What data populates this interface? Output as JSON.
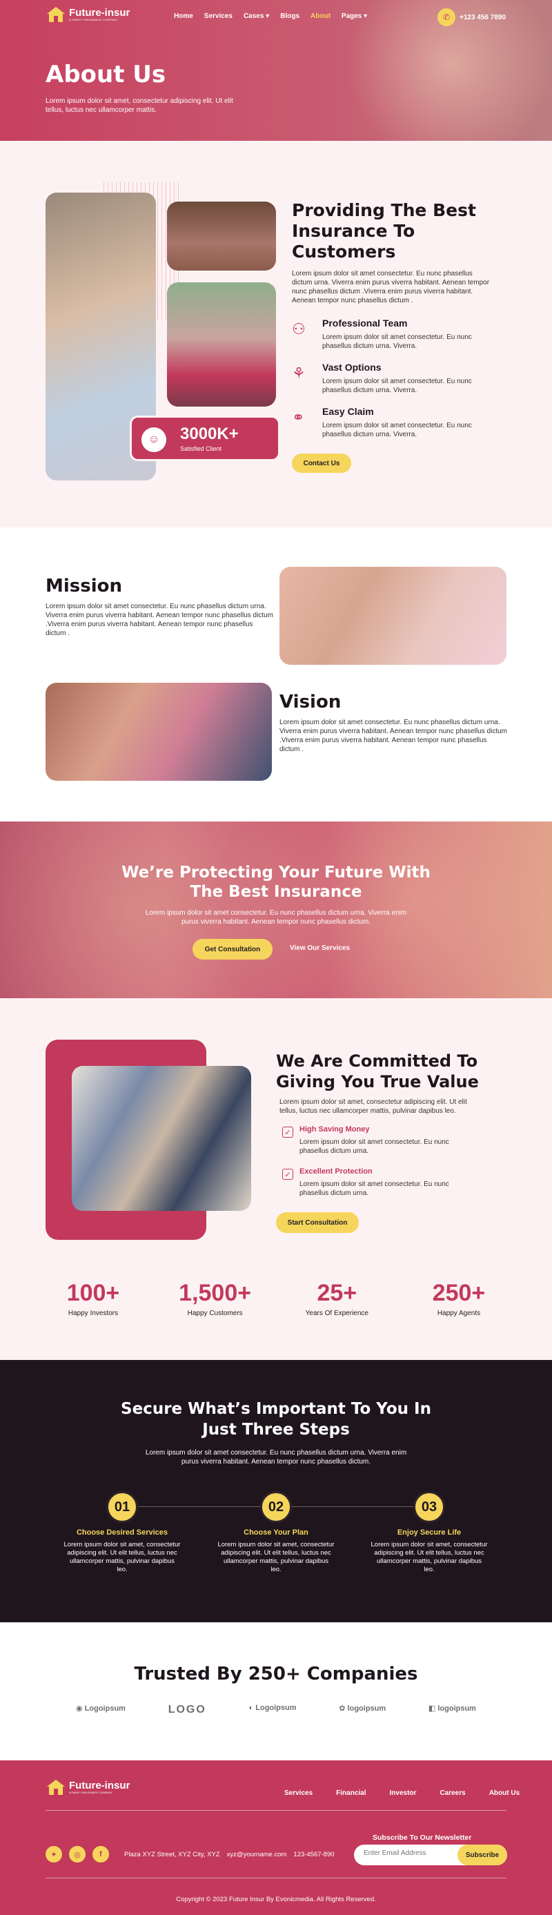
{
  "brand": {
    "name": "Future-insur",
    "tagline": "A FAMILY INSURANCE COMPANY"
  },
  "nav": {
    "items": [
      "Home",
      "Services",
      "Cases",
      "Blogs",
      "About",
      "Pages"
    ],
    "active": "About",
    "phone": "+123 456 7890"
  },
  "hero": {
    "title": "About Us",
    "text": "Lorem ipsum dolor sit amet, consectetur adipiscing elit. Ut elit tellus, luctus nec ullamcorper mattis."
  },
  "about": {
    "title": "Providing The Best Insurance To Customers",
    "text": "Lorem ipsum dolor sit amet consectetur. Eu nunc phasellus dictum urna. Viverra enim purus viverra habitant. Aenean tempor nunc phasellus dictum .Viverra enim purus viverra habitant. Aenean tempor nunc phasellus dictum .",
    "features": [
      {
        "title": "Professional Team",
        "text": "Lorem ipsum dolor sit amet consectetur. Eu nunc phasellus dictum urna. Viverra."
      },
      {
        "title": "Vast Options",
        "text": "Lorem ipsum dolor sit amet consectetur. Eu nunc phasellus dictum urna. Viverra."
      },
      {
        "title": "Easy Claim",
        "text": "Lorem ipsum dolor sit amet consectetur. Eu nunc phasellus dictum urna. Viverra."
      }
    ],
    "stat_value": "3000K+",
    "stat_label": "Satisfied Client",
    "cta": "Contact Us"
  },
  "mission": {
    "title": "Mission",
    "text": "Lorem ipsum dolor sit amet consectetur. Eu nunc phasellus dictum urna. Viverra enim purus viverra habitant. Aenean tempor nunc phasellus dictum .Viverra enim purus viverra habitant. Aenean tempor nunc phasellus dictum ."
  },
  "vision": {
    "title": "Vision",
    "text": "Lorem ipsum dolor sit amet consectetur. Eu nunc phasellus dictum urna. Viverra enim purus viverra habitant. Aenean tempor nunc phasellus dictum .Viverra enim purus viverra habitant. Aenean tempor nunc phasellus dictum ."
  },
  "banner": {
    "title": "We’re Protecting Your Future With The Best Insurance",
    "text": "Lorem ipsum dolor sit amet consectetur. Eu nunc phasellus dictum urna. Viverra enim purus viverra habitant. Aenean tempor nunc phasellus dictum.",
    "cta1": "Get Consultation",
    "cta2": "View Our Services"
  },
  "commit": {
    "title": "We Are Committed To Giving You True Value",
    "text": "Lorem ipsum dolor sit amet, consectetur adipiscing elit. Ut elit tellus, luctus nec ullamcorper mattis, pulvinar dapibus leo.",
    "items": [
      {
        "title": "High Saving Money",
        "text": "Lorem ipsum dolor sit amet consectetur. Eu nunc phasellus dictum urna."
      },
      {
        "title": "Excellent Protection",
        "text": "Lorem ipsum dolor sit amet consectetur. Eu nunc phasellus dictum urna."
      }
    ],
    "cta": "Start Consultation"
  },
  "stats": [
    {
      "value": "100+",
      "label": "Happy Investors"
    },
    {
      "value": "1,500+",
      "label": "Happy Customers"
    },
    {
      "value": "25+",
      "label": "Years Of Experience"
    },
    {
      "value": "250+",
      "label": "Happy Agents"
    }
  ],
  "steps": {
    "title": "Secure What’s Important To You In Just Three Steps",
    "text": "Lorem ipsum dolor sit amet consectetur. Eu nunc phasellus dictum urna. Viverra enim purus viverra habitant. Aenean tempor nunc phasellus dictum.",
    "items": [
      {
        "num": "01",
        "title": "Choose Desired Services",
        "text": "Lorem ipsum dolor sit amet, consectetur adipiscing elit. Ut elit tellus, luctus nec ullamcorper mattis, pulvinar dapibus leo."
      },
      {
        "num": "02",
        "title": "Choose Your Plan",
        "text": "Lorem ipsum dolor sit amet, consectetur adipiscing elit. Ut elit tellus, luctus nec ullamcorper mattis, pulvinar dapibus leo."
      },
      {
        "num": "03",
        "title": "Enjoy Secure Life",
        "text": "Lorem ipsum dolor sit amet, consectetur adipiscing elit. Ut elit tellus, luctus nec ullamcorper mattis, pulvinar dapibus leo."
      }
    ]
  },
  "trusted": {
    "title": "Trusted By 250+ Companies",
    "logos": [
      "Logoipsum",
      "LOGO",
      "Logoipsum",
      "logoipsum",
      "logoipsum"
    ]
  },
  "footer": {
    "links": [
      "Services",
      "Financial",
      "Investor",
      "Careers",
      "About Us"
    ],
    "address": "Plaza XYZ Street, XYZ City, XYZ",
    "email": "xyz@yourname.com",
    "phone": "123-4567-890",
    "newsletter_title": "Subscribe To Our Newsletter",
    "newsletter_placeholder": "Enter Email Address",
    "subscribe": "Subscribe",
    "copyright": "Copyright © 2023 Future Insur By Evonicmedia. All Rights Reserved."
  },
  "colors": {
    "primary": "#c2395b",
    "accent": "#f6d55c",
    "dark": "#1e161c",
    "light": "#fdf2f3"
  }
}
